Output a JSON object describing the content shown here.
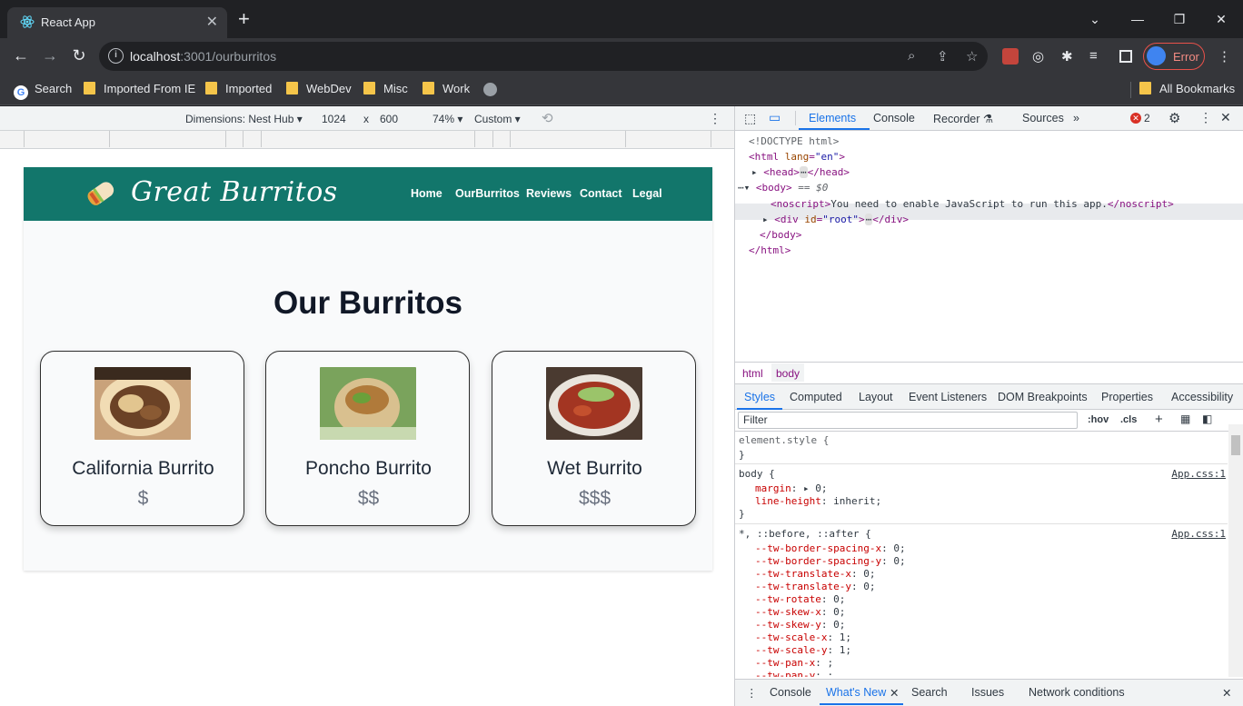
{
  "browser": {
    "tab_title": "React App",
    "url_host": "localhost",
    "url_path": ":3001/ourburritos",
    "profile_label": "Error",
    "bookmarks": [
      "Search",
      "Imported From IE",
      "Imported",
      "WebDev",
      "Misc",
      "Work"
    ],
    "all_bookmarks": "All Bookmarks"
  },
  "device_toolbar": {
    "dimensions": "Dimensions: Nest Hub",
    "width": "1024",
    "times": "x",
    "height": "600",
    "zoom": "74%",
    "throttle": "Custom"
  },
  "site": {
    "brand": "Great Burritos",
    "nav": [
      "Home",
      "OurBurritos",
      "Reviews",
      "Contact",
      "Legal"
    ],
    "heading": "Our Burritos",
    "cards": [
      {
        "name": "California Burrito",
        "price": "$"
      },
      {
        "name": "Poncho Burrito",
        "price": "$$"
      },
      {
        "name": "Wet Burrito",
        "price": "$$$"
      }
    ]
  },
  "devtools": {
    "tabs": [
      "Elements",
      "Console",
      "Recorder",
      "Sources"
    ],
    "error_count": "2",
    "dom": {
      "doctype": "<!DOCTYPE html>",
      "html_open": "<html",
      "lang_attr": "lang",
      "lang_val": "\"en\"",
      "head": "<head>",
      "head_close": "</head>",
      "body": "<body>",
      "body_marker": "== $0",
      "noscript_open": "<noscript>",
      "noscript_text": "You need to enable JavaScript to run this app.",
      "noscript_close": "</noscript>",
      "div_open": "<div",
      "id_attr": "id",
      "id_val": "\"root\"",
      "div_close": "</div>",
      "body_close": "</body>",
      "html_close": "</html>"
    },
    "breadcrumbs": [
      "html",
      "body"
    ],
    "subtabs": [
      "Styles",
      "Computed",
      "Layout",
      "Event Listeners",
      "DOM Breakpoints",
      "Properties",
      "Accessibility"
    ],
    "filter_placeholder": "Filter",
    "hov": ":hov",
    "cls": ".cls",
    "styles": {
      "element_style": "element.style {",
      "close": "}",
      "body_selector": "body {",
      "body_source": "App.css:1",
      "body_props": [
        {
          "name": "margin",
          "value": "▸ 0;"
        },
        {
          "name": "line-height",
          "value": "inherit;"
        }
      ],
      "universal_selector": "*, ::before, ::after {",
      "universal_source": "App.css:1",
      "universal_props": [
        {
          "name": "--tw-border-spacing-x",
          "value": "0;"
        },
        {
          "name": "--tw-border-spacing-y",
          "value": "0;"
        },
        {
          "name": "--tw-translate-x",
          "value": "0;"
        },
        {
          "name": "--tw-translate-y",
          "value": "0;"
        },
        {
          "name": "--tw-rotate",
          "value": "0;"
        },
        {
          "name": "--tw-skew-x",
          "value": "0;"
        },
        {
          "name": "--tw-skew-y",
          "value": "0;"
        },
        {
          "name": "--tw-scale-x",
          "value": "1;"
        },
        {
          "name": "--tw-scale-y",
          "value": "1;"
        },
        {
          "name": "--tw-pan-x",
          "value": ";"
        },
        {
          "name": "--tw-pan-y",
          "value": ";"
        }
      ]
    },
    "drawer_tabs": [
      "Console",
      "What's New",
      "Search",
      "Issues",
      "Network conditions"
    ]
  }
}
